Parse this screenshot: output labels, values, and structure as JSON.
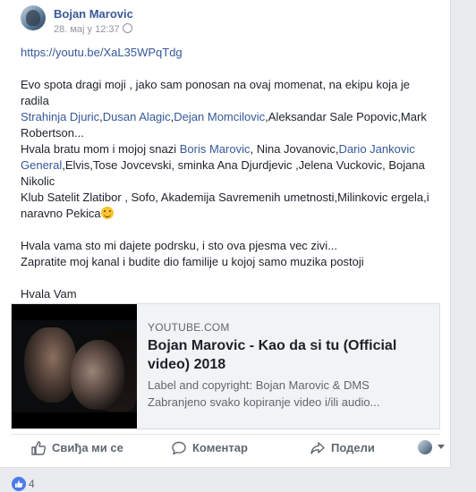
{
  "post": {
    "author": "Bojan Marovic",
    "timestamp": "28. мај у 12:37",
    "url": "https://youtu.be/XaL35WPqTdg",
    "lines": {
      "l1": "Evo spota dragi moji , jako sam ponosan na ovaj momenat, na ekipu koja je radila",
      "tag1": "Strahinja Djuric",
      "tag2": "Dusan Alagic",
      "tag3": "Dejan Momcilovic",
      "l2_rest": ",Aleksandar Sale Popovic,Mark Robertson...",
      "l3_start": "Hvala bratu mom i mojoj snazi ",
      "tag4": "Boris Marovic",
      "l3_mid": ", Nina Jovanovic,",
      "tag5": "Dario Jankovic General",
      "l3_rest": ",Elvis,Tose Jovcevski, sminka Ana Djurdjevic ,Jelena Vuckovic, Bojana Nikolic",
      "l4": "Klub Satelit Zlatibor , Sofo, Akademija Savremenih umetnosti,Milinkovic ergela,i naravno Pekica",
      "l5": "Hvala vama sto mi dajete podrsku, i sto ova pjesma vec zivi...",
      "l6": "Zapratite moj kanal i budite dio familije u kojoj samo muzika postoji",
      "l7": "Hvala Vam"
    }
  },
  "preview": {
    "source": "YOUTUBE.COM",
    "title": "Bojan Marovic - Kao da si tu (Official video) 2018",
    "desc1": "Label and copyright: Bojan Marovic & DMS",
    "desc2": "Zabranjeno svako kopiranje video i/ili audio..."
  },
  "actions": {
    "like": "Свиђа ми се",
    "comment": "Коментар",
    "share": "Подели"
  },
  "reactions": {
    "count": "4"
  },
  "colors": {
    "link": "#365899",
    "name": "#385898",
    "like_badge": "#4b7bec"
  }
}
